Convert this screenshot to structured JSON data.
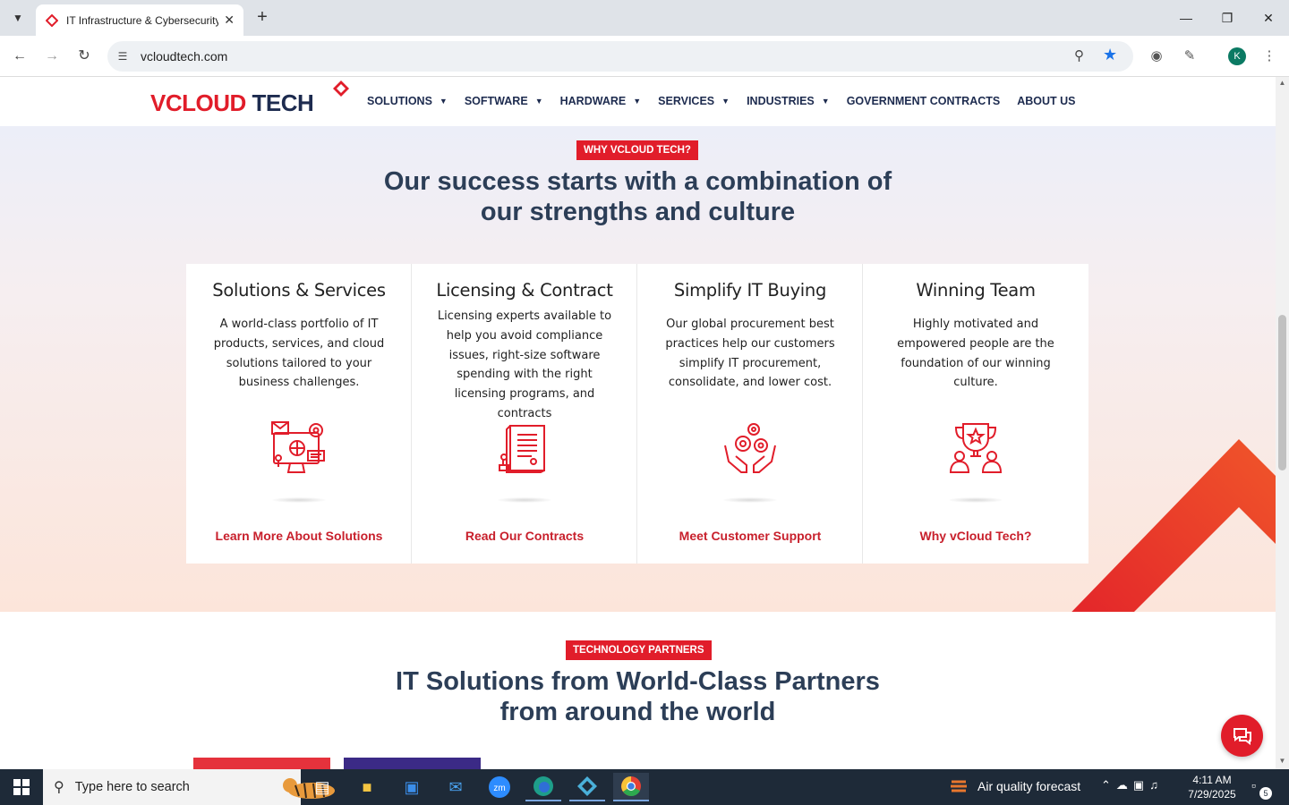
{
  "browser": {
    "tab_title": "IT Infrastructure & Cybersecurity",
    "url": "vcloudtech.com",
    "avatar_letter": "K"
  },
  "site": {
    "logo_text_1": "VCLOUD",
    "logo_text_2": "TECH",
    "nav": [
      {
        "label": "SOLUTIONS"
      },
      {
        "label": "SOFTWARE"
      },
      {
        "label": "HARDWARE"
      },
      {
        "label": "SERVICES"
      },
      {
        "label": "INDUSTRIES"
      },
      {
        "label": "GOVERNMENT CONTRACTS"
      },
      {
        "label": "ABOUT US"
      }
    ]
  },
  "strengths": {
    "pill": "WHY VCLOUD TECH?",
    "title_line1": "Our success starts with a combination of",
    "title_line2": "our strengths and culture",
    "cards": [
      {
        "title": "Solutions & Services",
        "text": "A world-class portfolio of IT products, services, and cloud solutions tailored to your business challenges.",
        "link": "Learn More About Solutions",
        "icon": "computer-network-icon"
      },
      {
        "title": "Licensing & Contract",
        "text": "Licensing experts available to help you avoid compliance issues, right-size software spending with the right licensing programs, and contracts",
        "link": "Read Our Contracts",
        "icon": "contract-stamp-icon"
      },
      {
        "title": "Simplify IT Buying",
        "text": "Our global procurement best practices help our customers simplify IT procurement, consolidate, and lower cost.",
        "link": "Meet Customer Support",
        "icon": "hands-gears-icon"
      },
      {
        "title": "Winning Team",
        "text": "Highly motivated and empowered people are the foundation of our winning culture.",
        "link": "Why vCloud Tech?",
        "icon": "trophy-team-icon"
      }
    ]
  },
  "partners": {
    "pill": "TECHNOLOGY PARTNERS",
    "title_line1": "IT Solutions from World-Class Partners",
    "title_line2": "from around the world"
  },
  "taskbar": {
    "search_placeholder": "Type here to search",
    "weather": "Air quality forecast",
    "time": "4:11 AM",
    "date": "7/29/2025",
    "notifications": "5"
  },
  "colors": {
    "brand_red": "#e11d2a",
    "navy": "#1d2b4f"
  }
}
